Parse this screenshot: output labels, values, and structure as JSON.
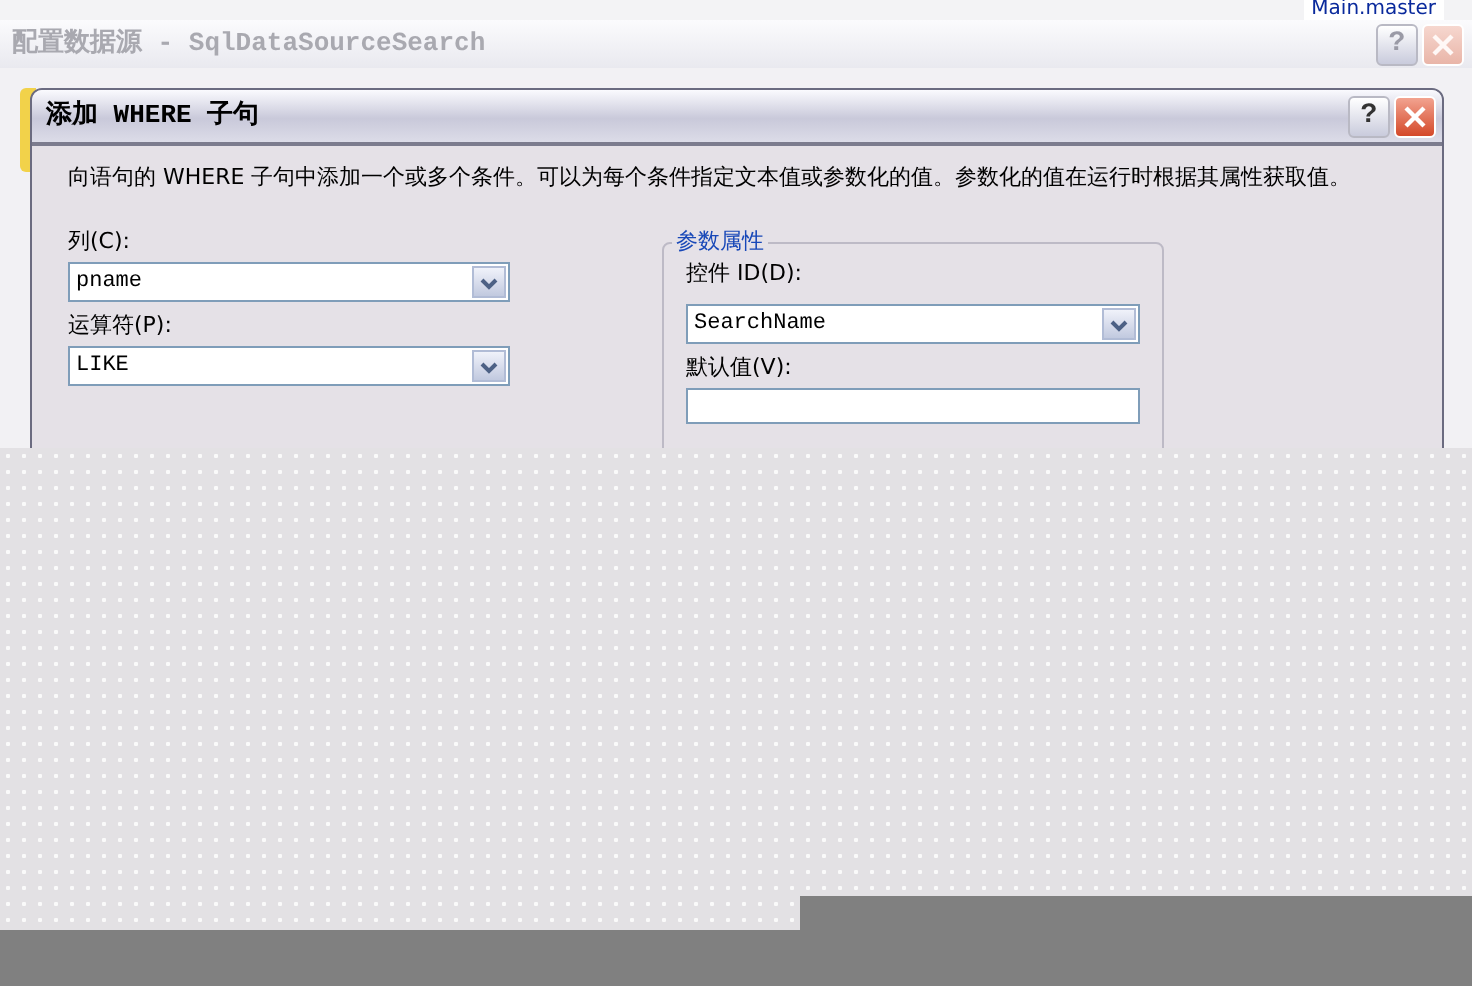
{
  "top_tab": {
    "title": "Main.master"
  },
  "window": {
    "title": "配置数据源 - SqlDataSourceSearch",
    "active": false,
    "help_glyph": "?"
  },
  "dialog": {
    "title": "添加 WHERE 子句",
    "active": true,
    "help_glyph": "?",
    "description": "向语句的 WHERE 子句中添加一个或多个条件。可以为每个条件指定文本值或参数化的值。参数化的值在运行时根据其属性获取值。",
    "fields": [
      {
        "label": "列(C):",
        "value": "pname",
        "kind": "select"
      },
      {
        "label": "运算符(P):",
        "value": "LIKE",
        "kind": "select"
      }
    ],
    "parameter_group": {
      "title": "参数属性",
      "fields": [
        {
          "label": "控件 ID(D):",
          "value": "SearchName",
          "kind": "select"
        },
        {
          "label": "默认值(V):",
          "kind": "text"
        }
      ]
    }
  }
}
